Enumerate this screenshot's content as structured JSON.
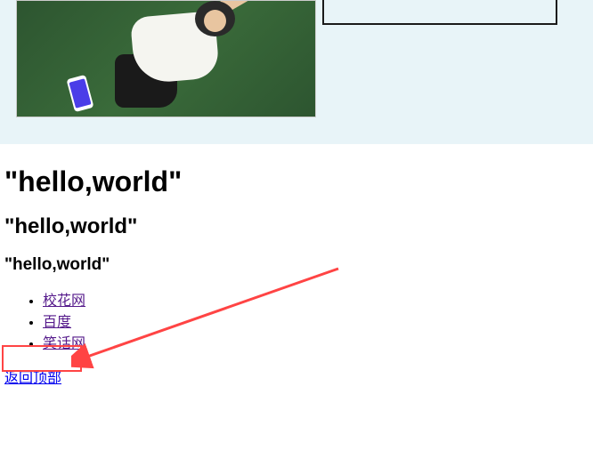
{
  "headings": {
    "h1": "\"hello,world\"",
    "h2": "\"hello,world\"",
    "h3": "\"hello,world\""
  },
  "links": [
    "校花网",
    "百度",
    "笑话网"
  ],
  "back_to_top": "返回顶部"
}
